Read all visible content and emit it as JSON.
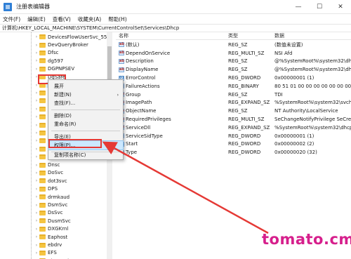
{
  "window": {
    "title": "注册表编辑器",
    "minimize": "—",
    "maximize": "☐",
    "close": "✕"
  },
  "menu": [
    "文件(F)",
    "编辑(E)",
    "查看(V)",
    "收藏夹(A)",
    "帮助(H)"
  ],
  "address": "计算机\\HKEY_LOCAL_MACHINE\\SYSTEM\\CurrentControlSet\\Services\\Dhcp",
  "tree": {
    "items": [
      {
        "label": "DevicesFlowUserSvc_5578",
        "expand": "›"
      },
      {
        "label": "DevQueryBroker",
        "expand": "›"
      },
      {
        "label": "Dfsc",
        "expand": "›"
      },
      {
        "label": "dg597",
        "expand": "›"
      },
      {
        "label": "DGPNPSEV",
        "expand": "›"
      },
      {
        "label": "DgSafe",
        "expand": "›"
      },
      {
        "label": "Dhcp",
        "expand": "›",
        "selected": true
      },
      {
        "label": "diagi",
        "expand": "›"
      },
      {
        "label": "diagi",
        "expand": "›"
      },
      {
        "label": "Diag",
        "expand": "›"
      },
      {
        "label": "disk",
        "expand": "›"
      },
      {
        "label": "Displ",
        "expand": "›"
      },
      {
        "label": "Displ",
        "expand": "›"
      },
      {
        "label": "DmE",
        "expand": "›"
      },
      {
        "label": "dmw",
        "expand": "›"
      },
      {
        "label": "dmw",
        "expand": "›"
      },
      {
        "label": "Dnsc",
        "expand": "›"
      },
      {
        "label": "DoSvc",
        "expand": "›"
      },
      {
        "label": "dot3svc",
        "expand": "›"
      },
      {
        "label": "DPS",
        "expand": "›"
      },
      {
        "label": "drmkaud",
        "expand": "›"
      },
      {
        "label": "DsmSvc",
        "expand": "›"
      },
      {
        "label": "DsSvc",
        "expand": "›"
      },
      {
        "label": "DusmSvc",
        "expand": "›"
      },
      {
        "label": "DXGKrnl",
        "expand": "›"
      },
      {
        "label": "Eaphost",
        "expand": "›"
      },
      {
        "label": "ebdrv",
        "expand": "›"
      },
      {
        "label": "EFS",
        "expand": "›"
      },
      {
        "label": "EhStorClass",
        "expand": "›"
      }
    ]
  },
  "values": {
    "headers": {
      "name": "名称",
      "type": "类型",
      "data": "数据"
    },
    "rows": [
      {
        "icon": "ab",
        "name": "(默认)",
        "type": "REG_SZ",
        "data": "(数值未设置)"
      },
      {
        "icon": "ab",
        "name": "DependOnService",
        "type": "REG_MULTI_SZ",
        "data": "NSI Afd"
      },
      {
        "icon": "ab",
        "name": "Description",
        "type": "REG_SZ",
        "data": "@%SystemRoot%\\system32\\dhcpc"
      },
      {
        "icon": "ab",
        "name": "DisplayName",
        "type": "REG_SZ",
        "data": "@%SystemRoot%\\system32\\dhcpc"
      },
      {
        "icon": "01",
        "name": "ErrorControl",
        "type": "REG_DWORD",
        "data": "0x00000001 (1)"
      },
      {
        "icon": "01",
        "name": "FailureActions",
        "type": "REG_BINARY",
        "data": "80 51 01 00 00 00 00 00 00 00 00 0"
      },
      {
        "icon": "ab",
        "name": "Group",
        "type": "REG_SZ",
        "data": "TDI"
      },
      {
        "icon": "ab",
        "name": "ImagePath",
        "type": "REG_EXPAND_SZ",
        "data": "%SystemRoot%\\system32\\svchost"
      },
      {
        "icon": "ab",
        "name": "ObjectName",
        "type": "REG_SZ",
        "data": "NT Authority\\LocalService"
      },
      {
        "icon": "ab",
        "name": "RequiredPrivileges",
        "type": "REG_MULTI_SZ",
        "data": "SeChangeNotifyPrivilege SeCreate"
      },
      {
        "icon": "ab",
        "name": "ServiceDll",
        "type": "REG_EXPAND_SZ",
        "data": "%SystemRoot%\\system32\\dhcpcor"
      },
      {
        "icon": "01",
        "name": "ServiceSidType",
        "type": "REG_DWORD",
        "data": "0x00000001 (1)"
      },
      {
        "icon": "01",
        "name": "Start",
        "type": "REG_DWORD",
        "data": "0x00000002 (2)"
      },
      {
        "icon": "01",
        "name": "Type",
        "type": "REG_DWORD",
        "data": "0x00000020 (32)"
      }
    ]
  },
  "context_menu": {
    "items": [
      {
        "label": "展开",
        "arrow": ""
      },
      {
        "label": "新建(N)",
        "arrow": "›"
      },
      {
        "label": "查找(F)...",
        "arrow": ""
      },
      {
        "label": "删除(D)",
        "arrow": ""
      },
      {
        "label": "重命名(R)",
        "arrow": ""
      },
      {
        "label": "导出(E)",
        "arrow": ""
      },
      {
        "label": "权限(P)...",
        "arrow": ""
      },
      {
        "label": "复制项名称(C)",
        "arrow": ""
      }
    ]
  },
  "watermark": "tomato.cm",
  "colors": {
    "highlight_box": "#e53935",
    "selection": "#cce8ff",
    "watermark": "#d61f8c"
  }
}
